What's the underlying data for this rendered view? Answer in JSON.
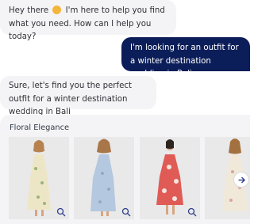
{
  "chat": {
    "greeting_before": "Hey there",
    "greeting_after": "I'm here to help you find what you need. How can I help you today?",
    "user_message": "I'm looking for an outfit for a winter destination wedding in Bali",
    "bot_reply": "Sure, let's find you the perfect outfit for a winter destination wedding in Bali"
  },
  "carousel": {
    "title": "Floral Elegance",
    "products": [
      {
        "dress_color": "#ede6c6",
        "accent": "#9bb37a",
        "zoom_icon": "zoom-icon"
      },
      {
        "dress_color": "#b4c8df",
        "accent": "#8aa3c4",
        "zoom_icon": "zoom-icon"
      },
      {
        "dress_color": "#e05b55",
        "accent": "#f4e6df",
        "zoom_icon": "zoom-icon"
      },
      {
        "dress_color": "#f0e8d9",
        "accent": "#d9a4a4",
        "zoom_icon": "zoom-icon"
      }
    ],
    "next_icon": "arrow-right-icon"
  },
  "colors": {
    "user_bubble": "#0b1e59",
    "bot_bubble": "#f4f4f6",
    "icon": "#2f3f8a"
  }
}
